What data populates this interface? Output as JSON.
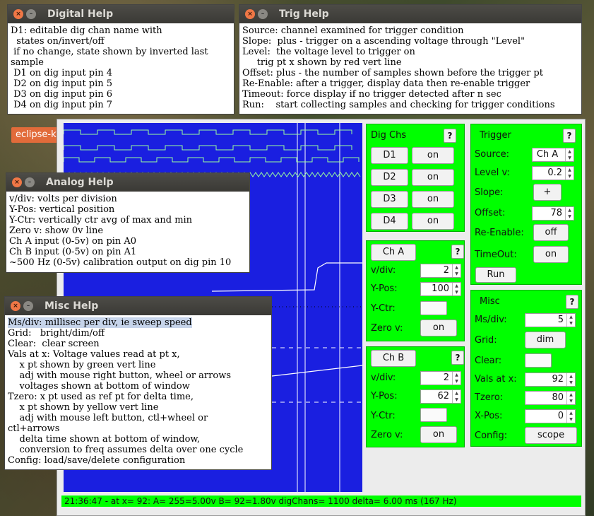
{
  "desktop": {
    "launcher_label": "eclipse-k"
  },
  "dig_chs": {
    "title": "Dig Chs",
    "help": "?",
    "channels": [
      {
        "name": "D1",
        "state": "on"
      },
      {
        "name": "D2",
        "state": "on"
      },
      {
        "name": "D3",
        "state": "on"
      },
      {
        "name": "D4",
        "state": "on"
      }
    ]
  },
  "ch_a": {
    "title": "Ch A",
    "help": "?",
    "vdiv_label": "v/div:",
    "vdiv": "2",
    "ypos_label": "Y-Pos:",
    "ypos": "100",
    "yctr_label": "Y-Ctr:",
    "zero_label": "Zero v:",
    "zero": "on"
  },
  "ch_b": {
    "title": "Ch B",
    "help": "?",
    "vdiv_label": "v/div:",
    "vdiv": "2",
    "ypos_label": "Y-Pos:",
    "ypos": "62",
    "yctr_label": "Y-Ctr:",
    "zero_label": "Zero v:",
    "zero": "on"
  },
  "trigger": {
    "title": "Trigger",
    "help": "?",
    "source_label": "Source:",
    "source": "Ch A",
    "level_label": "Level v:",
    "level": "0.2",
    "slope_label": "Slope:",
    "slope": "+",
    "offset_label": "Offset:",
    "offset": "78",
    "reenable_label": "Re-Enable:",
    "reenable": "off",
    "timeout_label": "TimeOut:",
    "timeout": "on",
    "run": "Run"
  },
  "misc": {
    "title": "Misc",
    "help": "?",
    "msdiv_label": "Ms/div:",
    "msdiv": "5",
    "grid_label": "Grid:",
    "grid": "dim",
    "clear_label": "Clear:",
    "vals_label": "Vals at x:",
    "vals": "92",
    "tzero_label": "Tzero:",
    "tzero": "80",
    "xpos_label": "X-Pos:",
    "xpos": "0",
    "config_label": "Config:",
    "config": "scope"
  },
  "status": "21:36:47 - at x= 92:  A= 255=5.00v  B= 92=1.80v  digChans= 1100 delta= 6.00 ms  (167 Hz)",
  "digital_help": {
    "title": "Digital Help",
    "lines": [
      "D1: editable dig chan name with",
      "  states on/invert/off",
      " if no change, state shown by inverted last",
      "sample",
      " D1 on dig input pin 4",
      " D2 on dig input pin 5",
      " D3 on dig input pin 6",
      " D4 on dig input pin 7"
    ]
  },
  "trig_help": {
    "title": "Trig Help",
    "lines": [
      "Source: channel examined for trigger condition",
      "Slope:  plus - trigger on a ascending voltage through \"Level\"",
      "Level:  the voltage level to trigger on",
      "     trig pt x shown by red vert line",
      "Offset: plus - the number of samples shown before the trigger pt",
      "Re-Enable: after a trigger, display data then re-enable trigger",
      "Timeout: force display if no trigger detected after n sec",
      "Run:    start collecting samples and checking for trigger conditions"
    ]
  },
  "analog_help": {
    "title": "Analog Help",
    "lines": [
      "v/div: volts per division",
      "Y-Pos: vertical position",
      "Y-Ctr: vertically ctr avg of max and min",
      "Zero v: show 0v line",
      "Ch A input (0-5v) on pin A0",
      "Ch B input (0-5v) on pin A1",
      "~500 Hz (0-5v) calibration output on dig pin 10"
    ]
  },
  "misc_help": {
    "title": "Misc Help",
    "first_line": "Ms/div: millisec per div, ie sweep speed",
    "lines": [
      "Grid:   bright/dim/off",
      "Clear:  clear screen",
      "Vals at x: Voltage values read at pt x,",
      "    x pt shown by green vert line",
      "    adj with mouse right button, wheel or arrows",
      "    voltages shown at bottom of window",
      "Tzero: x pt used as ref pt for delta time,",
      "    x pt shown by yellow vert line",
      "    adj with mouse left button, ctl+wheel or",
      "ctl+arrows",
      "    delta time shown at bottom of window,",
      "    conversion to freq assumes delta over one cycle",
      "Config: load/save/delete configuration"
    ]
  },
  "colors": {
    "scope_bg": "#1a1fe0",
    "panel_bg": "#00ff00",
    "trace": "#ffffff",
    "dig_trace": "#9cff9c"
  }
}
